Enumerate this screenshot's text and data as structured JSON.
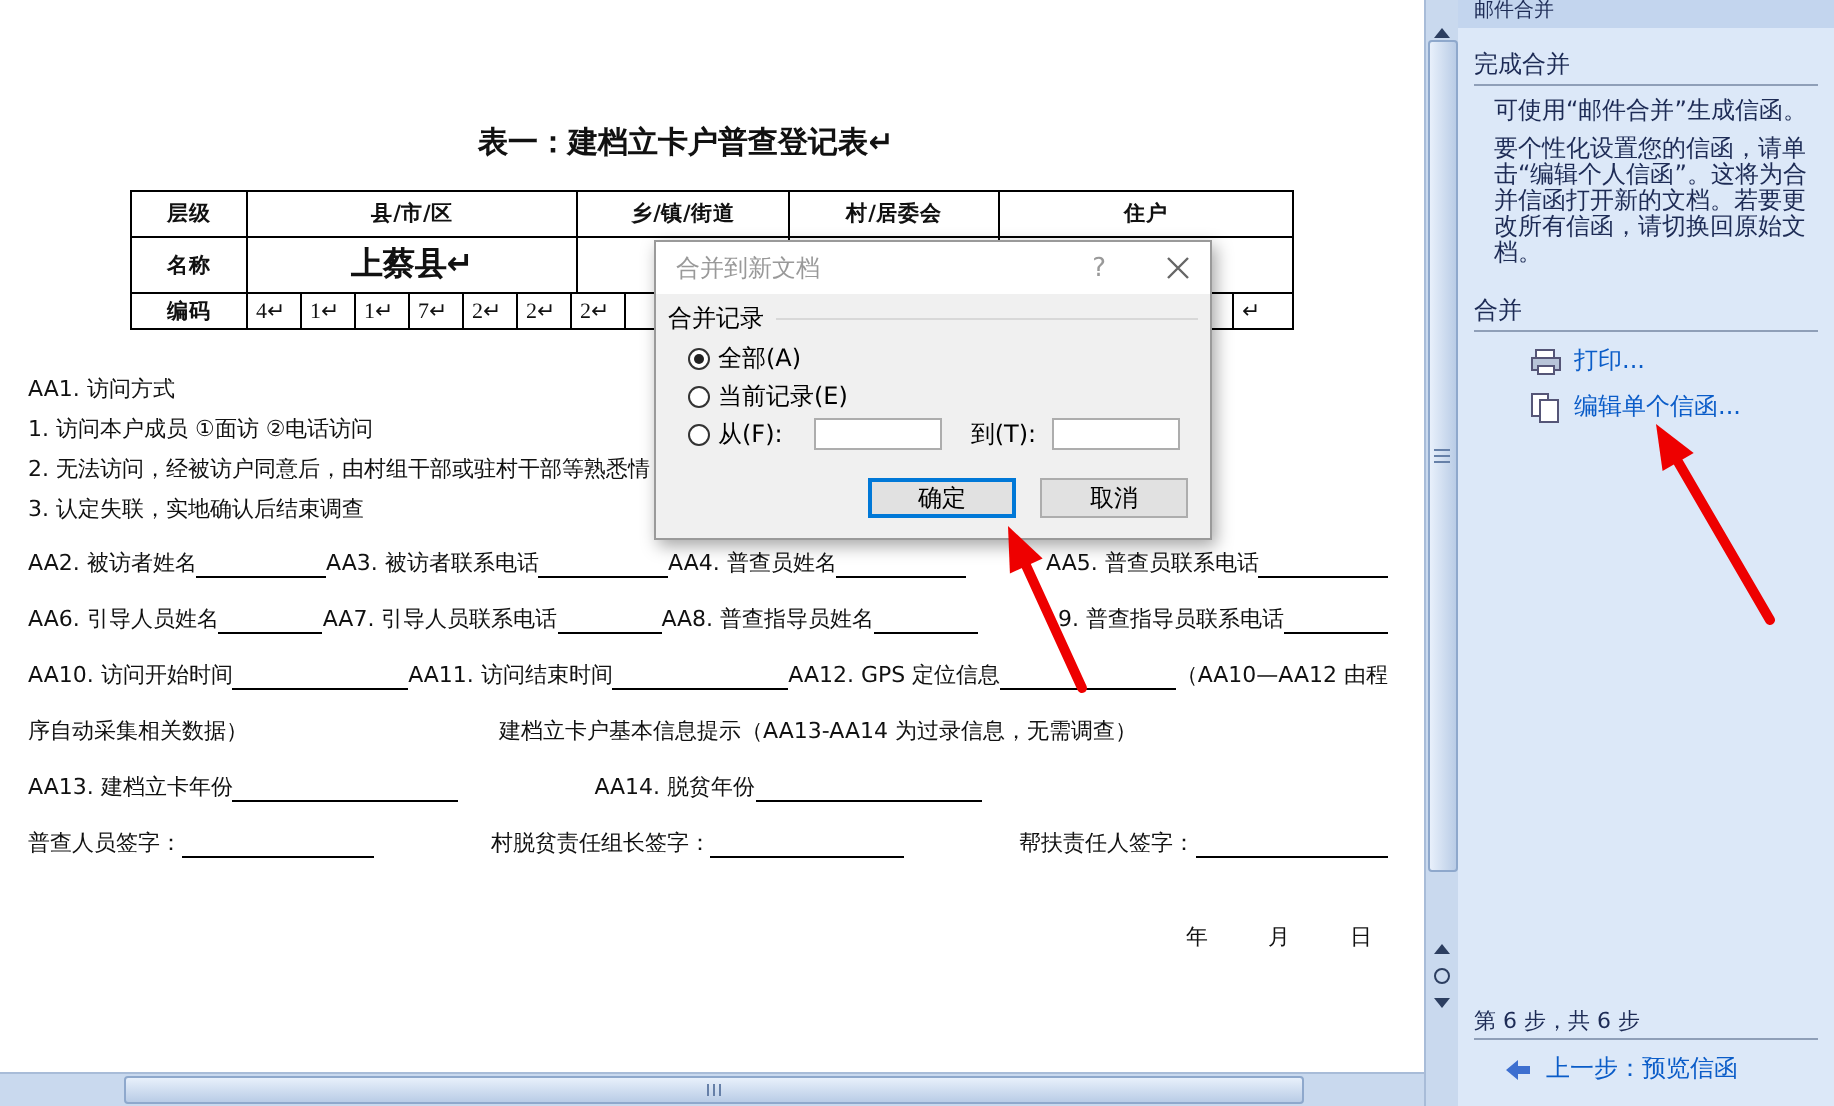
{
  "document": {
    "title": "表一：建档立卡户普查登记表↵",
    "table": {
      "header": [
        "层级",
        "县/市/区",
        "乡/镇/街道",
        "村/居委会",
        "住户"
      ],
      "name_row": {
        "label": "名称",
        "county": "上蔡县↵"
      },
      "code_row": {
        "label": "编码",
        "leading": [
          "4↵",
          "1↵",
          "1↵",
          "7↵",
          "2↵",
          "2↵",
          "2↵"
        ],
        "trailing": [
          "↵"
        ]
      }
    },
    "notes": [
      "AA1. 访问方式",
      "1. 访问本户成员    ①面访    ②电话访问",
      "2. 无法访问，经被访户同意后，由村组干部或驻村干部等熟悉情",
      "3. 认定失联，实地确认后结束调查"
    ],
    "form_lines": [
      [
        {
          "kind": "text",
          "text": "AA2. 被访者姓名"
        },
        {
          "kind": "blank"
        },
        {
          "kind": "text",
          "text": "AA3. 被访者联系电话"
        },
        {
          "kind": "blank"
        },
        {
          "kind": "text",
          "text": "AA4. 普查员姓名"
        },
        {
          "kind": "blank"
        },
        {
          "kind": "space"
        },
        {
          "kind": "text",
          "text": "AA5. 普查员联系电话"
        },
        {
          "kind": "blank"
        }
      ],
      [
        {
          "kind": "text",
          "text": "AA6. 引导人员姓名"
        },
        {
          "kind": "blank"
        },
        {
          "kind": "text",
          "text": "AA7. 引导人员联系电话"
        },
        {
          "kind": "blank"
        },
        {
          "kind": "text",
          "text": "AA8. 普查指导员姓名"
        },
        {
          "kind": "blank"
        },
        {
          "kind": "space"
        },
        {
          "kind": "text",
          "text": "9. 普查指导员联系电话"
        },
        {
          "kind": "blank"
        }
      ],
      [
        {
          "kind": "text",
          "text": "AA10. 访问开始时间"
        },
        {
          "kind": "blank"
        },
        {
          "kind": "text",
          "text": "AA11. 访问结束时间"
        },
        {
          "kind": "blank"
        },
        {
          "kind": "text",
          "text": "AA12. GPS 定位信息"
        },
        {
          "kind": "blank"
        },
        {
          "kind": "text",
          "text": "（AA10—AA12 由程"
        }
      ],
      [
        {
          "kind": "text",
          "text": "序自动采集相关数据）"
        },
        {
          "kind": "gap"
        },
        {
          "kind": "text",
          "text": "建档立卡户基本信息提示（AA13-AA14 为过录信息，无需调查）"
        },
        {
          "kind": "gap"
        }
      ],
      [
        {
          "kind": "text",
          "text": "AA13. 建档立卡年份"
        },
        {
          "kind": "blank"
        },
        {
          "kind": "gap"
        },
        {
          "kind": "text",
          "text": "AA14. 脱贫年份"
        },
        {
          "kind": "blank"
        },
        {
          "kind": "gap"
        },
        {
          "kind": "gap"
        },
        {
          "kind": "gap"
        }
      ],
      [
        {
          "kind": "text",
          "text": "普查人员签字："
        },
        {
          "kind": "blank"
        },
        {
          "kind": "gap"
        },
        {
          "kind": "text",
          "text": "村脱贫责任组长签字："
        },
        {
          "kind": "blank"
        },
        {
          "kind": "gap"
        },
        {
          "kind": "text",
          "text": "帮扶责任人签字："
        },
        {
          "kind": "blank"
        }
      ]
    ],
    "date": [
      "年",
      "月",
      "日"
    ]
  },
  "dialog": {
    "title": "合并到新文档",
    "help": "?",
    "group": "合并记录",
    "options": [
      {
        "label": "全部(A)",
        "selected": true
      },
      {
        "label": "当前记录(E)",
        "selected": false
      },
      {
        "label": "从(F):",
        "selected": false
      }
    ],
    "to_label": "到(T):",
    "buttons": [
      {
        "label": "确定",
        "focused": true
      },
      {
        "label": "取消",
        "focused": false
      }
    ]
  },
  "task_pane": {
    "title": "邮件合并",
    "sections": [
      {
        "heading": "完成合并",
        "paragraphs": [
          "可使用“邮件合并”生成信函。",
          "要个性化设置您的信函，请单击“编辑个人信函”。这将为合并信函打开新的文档。若要更改所有信函，请切换回原始文档。"
        ]
      },
      {
        "heading": "合并",
        "links": [
          {
            "kind": "print",
            "label": "打印..."
          },
          {
            "kind": "edit",
            "label": "编辑单个信函..."
          }
        ]
      }
    ],
    "step": "第 6 步，共 6 步",
    "back": "上一步：预览信函"
  }
}
